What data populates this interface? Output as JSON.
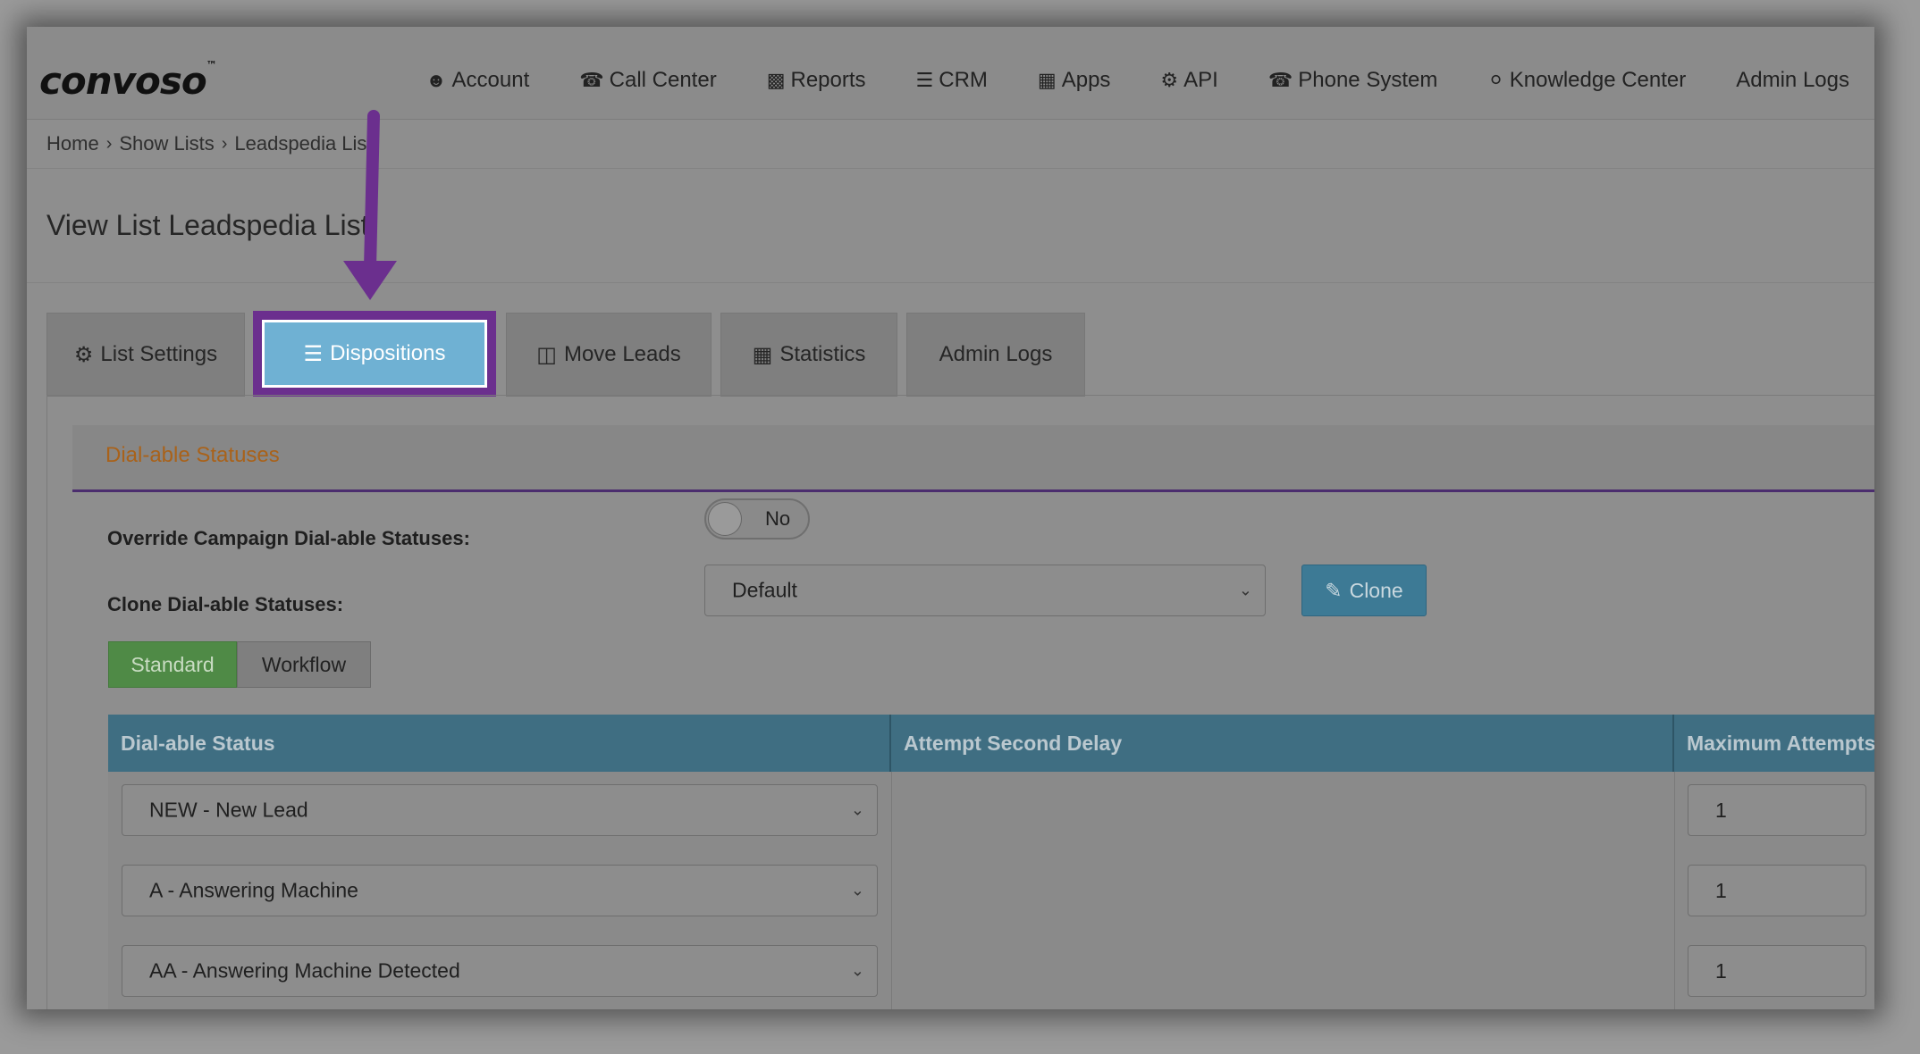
{
  "brand": {
    "logo_text": "convoso"
  },
  "nav": {
    "items": [
      {
        "label": "Account",
        "icon": "user-icon"
      },
      {
        "label": "Call Center",
        "icon": "phone-icon"
      },
      {
        "label": "Reports",
        "icon": "bar-chart-icon"
      },
      {
        "label": "CRM",
        "icon": "list-icon"
      },
      {
        "label": "Apps",
        "icon": "grid-icon"
      },
      {
        "label": "API",
        "icon": "gear-icon"
      },
      {
        "label": "Phone System",
        "icon": "phone-icon"
      },
      {
        "label": "Knowledge Center",
        "icon": "lightbulb-icon"
      },
      {
        "label": "Admin Logs",
        "icon": ""
      }
    ]
  },
  "breadcrumb": [
    "Home",
    "Show Lists",
    "Leadspedia List"
  ],
  "page": {
    "title": "View List Leadspedia List"
  },
  "tabs": [
    {
      "label": "List Settings",
      "icon": "gear-icon"
    },
    {
      "label": "Dispositions",
      "icon": "list-icon",
      "active": true
    },
    {
      "label": "Move Leads",
      "icon": "document-icon"
    },
    {
      "label": "Statistics",
      "icon": "table-icon"
    },
    {
      "label": "Admin Logs",
      "icon": ""
    }
  ],
  "section": {
    "title": "Dial-able Statuses",
    "override_label": "Override Campaign Dial-able Statuses:",
    "override_value": "No",
    "clone_label": "Clone Dial-able Statuses:",
    "clone_select_value": "Default",
    "clone_button": "Clone",
    "mode_options": [
      "Standard",
      "Workflow"
    ],
    "mode_selected": "Standard"
  },
  "table": {
    "headers": [
      "Dial-able Status",
      "Attempt Second Delay",
      "Maximum Attempts"
    ],
    "rows": [
      {
        "status": "NEW - New Lead",
        "delay": "",
        "max": "1"
      },
      {
        "status": "A - Answering Machine",
        "delay": "",
        "max": "1"
      },
      {
        "status": "AA - Answering Machine Detected",
        "delay": "",
        "max": "1"
      }
    ]
  },
  "colors": {
    "annotation": "#6b2f8e",
    "active_tab": "#6fb1d3",
    "table_header": "#3f6e82",
    "standard_button": "#4f8a46",
    "clone_button": "#3d7a95",
    "section_title": "#a9621a"
  }
}
